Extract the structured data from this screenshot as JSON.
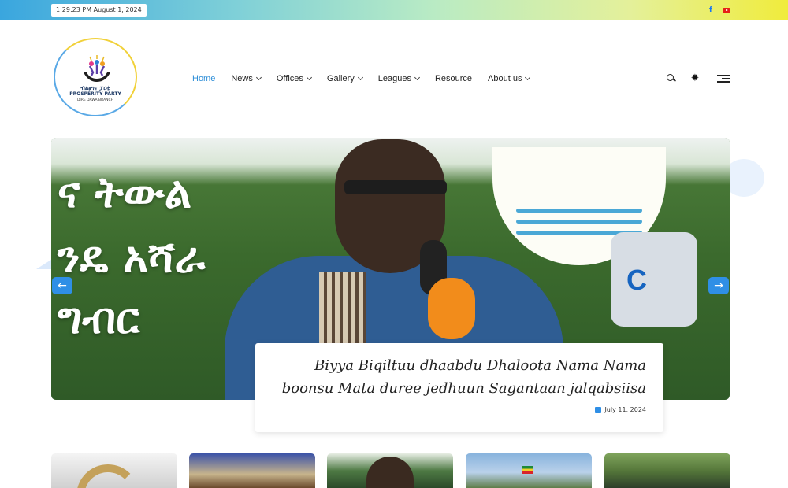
{
  "topbar": {
    "datetime": "1:29:23 PM August 1, 2024",
    "social": [
      {
        "icon": "facebook-icon",
        "glyph": "f"
      },
      {
        "icon": "youtube-icon"
      }
    ]
  },
  "logo": {
    "line1": "ብልፅግና ፓርቲ",
    "line2": "PROSPERITY PARTY",
    "line3": "DIRE DAWA BRANCH"
  },
  "nav": {
    "items": [
      {
        "label": "Home",
        "active": true,
        "dropdown": false
      },
      {
        "label": "News",
        "active": false,
        "dropdown": true
      },
      {
        "label": "Offices",
        "active": false,
        "dropdown": true
      },
      {
        "label": "Gallery",
        "active": false,
        "dropdown": true
      },
      {
        "label": "Leagues",
        "active": false,
        "dropdown": true
      },
      {
        "label": "Resource",
        "active": false,
        "dropdown": false
      },
      {
        "label": "About us",
        "active": false,
        "dropdown": true
      }
    ]
  },
  "header_icons": [
    "search-icon",
    "settings-icon",
    "menu-icon"
  ],
  "hero": {
    "background_text": [
      "ና ትውል",
      "ንዴ አሻራ",
      "ግብር"
    ],
    "caption_title": "Biyya Biqiltuu dhaabdu Dhaloota Nama Nama boonsu Mata duree jedhuun Sagantaan jalqabsiisa",
    "caption_date": "July 11, 2024",
    "prev_label": "←",
    "next_label": "→",
    "mic_logo": "C"
  },
  "thumbnails_count": 5,
  "colors": {
    "accent": "#2f8fe6",
    "nav_active": "#2f8fd8",
    "youtube": "#e62117",
    "facebook": "#1877f2"
  }
}
